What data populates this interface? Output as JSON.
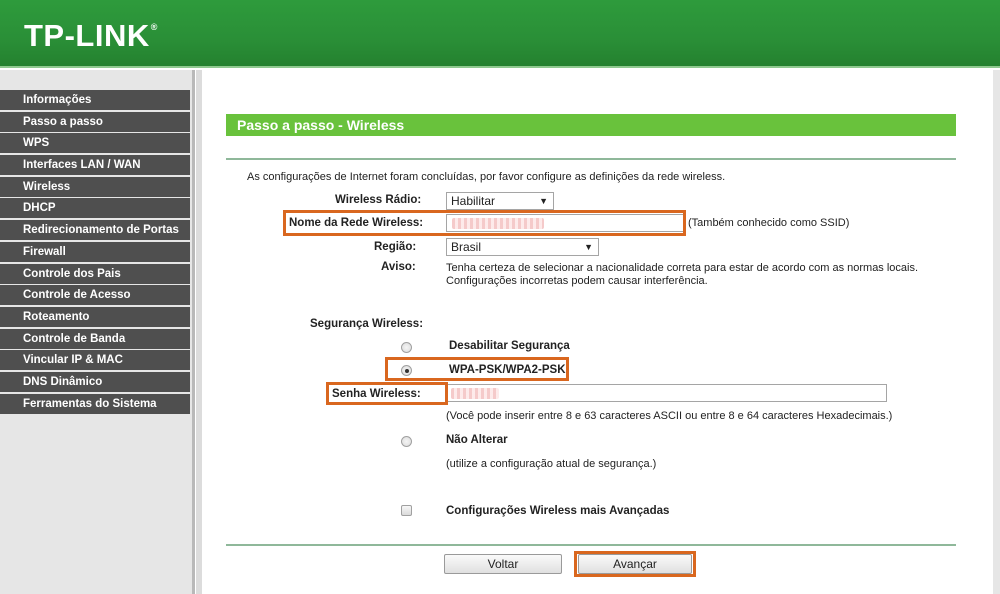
{
  "header": {
    "logo_text": "TP-LINK",
    "logo_mark": "®"
  },
  "menu": [
    "Informações",
    "Passo a passo",
    "WPS",
    "Interfaces LAN / WAN",
    "Wireless",
    "DHCP",
    "Redirecionamento de Portas",
    "Firewall",
    "Controle dos Pais",
    "Controle de Acesso",
    "Roteamento",
    "Controle de Banda",
    "Vincular IP & MAC",
    "DNS Dinâmico",
    "Ferramentas do Sistema"
  ],
  "page": {
    "title": "Passo a passo - Wireless",
    "intro": "As configurações de Internet foram concluídas, por favor configure as definições da rede wireless."
  },
  "form": {
    "radio_label": "Wireless Rádio:",
    "radio_value": "Habilitar",
    "ssid_label": "Nome da Rede Wireless:",
    "ssid_note": "(Também conhecido como SSID)",
    "region_label": "Região:",
    "region_value": "Brasil",
    "warning_label": "Aviso:",
    "warning_line1": "Tenha certeza de selecionar a nacionalidade correta para estar de acordo com as normas locais.",
    "warning_line2": "Configurações incorretas podem causar interferência.",
    "security_label": "Segurança Wireless:",
    "disable_security": "Desabilitar Segurança",
    "wpa_option": "WPA-PSK/WPA2-PSK",
    "password_label": "Senha Wireless:",
    "password_hint": "(Você pode inserir entre 8 e 63 caracteres ASCII ou entre 8 e 64 caracteres Hexadecimais.)",
    "no_change": "Não Alterar",
    "no_change_hint": "(utilize a configuração atual de segurança.)",
    "advanced": "Configurações Wireless mais Avançadas",
    "selected_security": "WPA-PSK/WPA2-PSK",
    "advanced_checked": false
  },
  "buttons": {
    "back": "Voltar",
    "next": "Avançar"
  },
  "colors": {
    "header_green": "#2a8f37",
    "section_green": "#69c23c",
    "menu_bg": "#4f4f4f",
    "highlight": "#d9671f"
  }
}
